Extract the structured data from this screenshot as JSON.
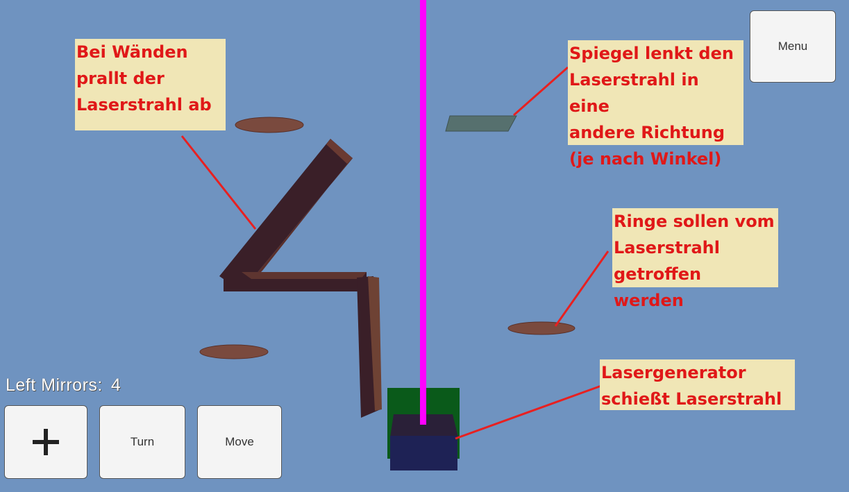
{
  "hud": {
    "mirrors_label": "Left Mirrors:",
    "mirrors_count": "4"
  },
  "buttons": {
    "menu": "Menu",
    "add_icon": "plus-icon",
    "turn": "Turn",
    "move": "Move"
  },
  "annotations": {
    "walls": "Bei Wänden\nprallt der\nLaserstrahl ab",
    "mirror": "Spiegel lenkt den\nLaserstrahl in eine\nandere Richtung\n(je nach Winkel)",
    "rings": "Ringe sollen vom\nLaserstrahl\ngetroffen werden",
    "generator": "Lasergenerator\nschießt Laserstrahl"
  },
  "colors": {
    "background": "#6f93c0",
    "laser": "#ff00ff",
    "annotation_text": "#e01818",
    "annotation_bg": "#f0e6b6",
    "wall": "#3a2028",
    "ring": "#7a4a3e",
    "mirror": "#56706e",
    "generator_base": "#1e2255",
    "generator_plate": "#0a5a1a"
  }
}
